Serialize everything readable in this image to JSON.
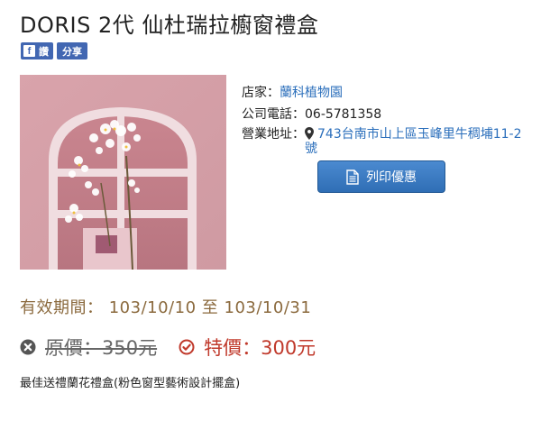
{
  "title": "DORIS 2代 仙杜瑞拉櫥窗禮盒",
  "social": {
    "like_label": "讚",
    "share_label": "分享",
    "fb_glyph": "f"
  },
  "store": {
    "name_label": "店家：",
    "name": "蘭科植物園",
    "phone_label": "公司電話：",
    "phone": "06-5781358",
    "address_label": "營業地址：",
    "address": "743台南市山上區玉峰里牛稠埔11-2號"
  },
  "print_button_label": "列印優惠",
  "validity": {
    "label": "有效期間：",
    "start": "103/10/10",
    "to": "至",
    "end": "103/10/31"
  },
  "price": {
    "original_label": "原價：",
    "original_value": "350元",
    "special_label": "特價：",
    "special_value": "300元"
  },
  "description": "最佳送禮蘭花禮盒(粉色窗型藝術設計擺盒)",
  "colors": {
    "accent": "#2a6ebb",
    "special_price": "#c0392b",
    "validity": "#8b6a3e",
    "facebook": "#4267b2"
  },
  "icons": {
    "like": "facebook-like-icon",
    "map": "map-marker-icon",
    "print": "document-icon",
    "original_price": "times-circle-icon",
    "special_price": "check-circle-icon"
  }
}
